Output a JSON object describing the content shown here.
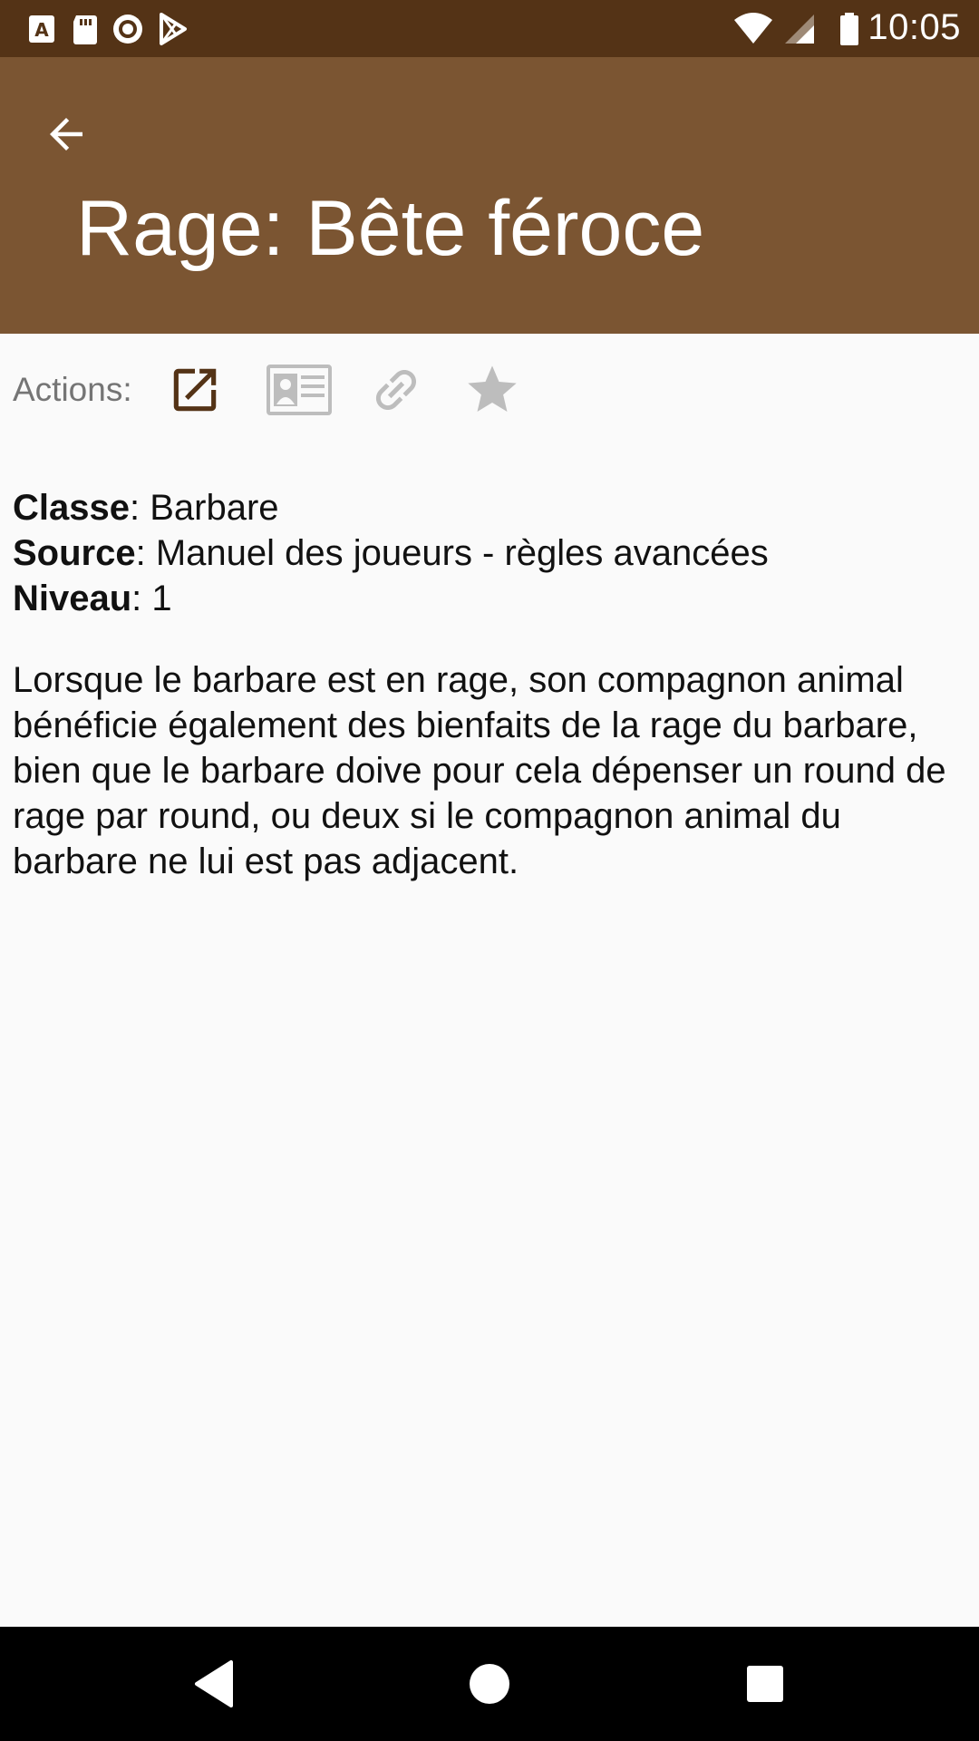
{
  "status_bar": {
    "time": "10:05",
    "icons": [
      "app-notification-icon",
      "sd-card-icon",
      "record-icon",
      "play-store-icon",
      "wifi-icon",
      "signal-icon",
      "battery-icon"
    ]
  },
  "app_bar": {
    "title": "Rage: Bête féroce",
    "back_icon": "arrow-back-icon",
    "color": "#7b5532"
  },
  "actions": {
    "label": "Actions:",
    "buttons": [
      "open-external-icon",
      "id-card-icon",
      "link-icon",
      "star-icon"
    ]
  },
  "details": {
    "classe_label": "Classe",
    "classe_value": ": Barbare",
    "source_label": "Source",
    "source_value": ": Manuel des joueurs - règles avancées",
    "niveau_label": "Niveau",
    "niveau_value": ": 1",
    "description": "Lorsque le barbare est en rage, son compagnon animal bénéficie également des bienfaits de la rage du barbare, bien que le barbare doive pour cela dépenser un round de rage par round, ou deux si le compagnon animal du barbare ne lui est pas adjacent."
  },
  "nav_bar": {
    "buttons": [
      "back-triangle-icon",
      "home-circle-icon",
      "recents-square-icon"
    ]
  }
}
